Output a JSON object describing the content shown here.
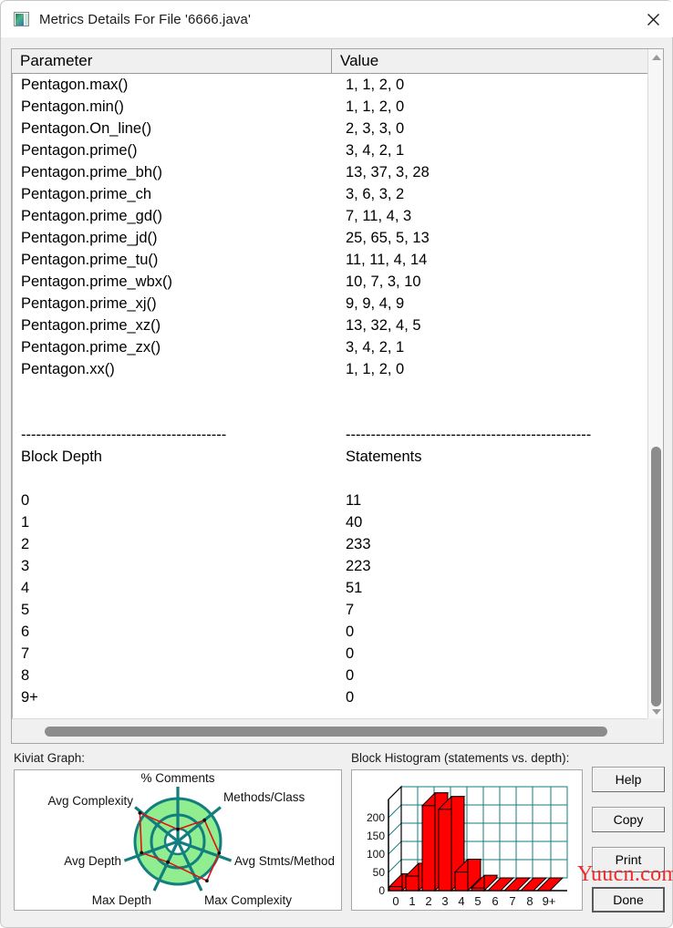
{
  "window": {
    "title": "Metrics Details For File '6666.java'",
    "icon": "app-window-icon",
    "close_label": "×"
  },
  "table": {
    "columns": [
      "Parameter",
      "Value"
    ],
    "rows": [
      {
        "parameter": "Pentagon.max()",
        "value": "1, 1, 2, 0"
      },
      {
        "parameter": "Pentagon.min()",
        "value": "1, 1, 2, 0"
      },
      {
        "parameter": "Pentagon.On_line()",
        "value": "2, 3, 3, 0"
      },
      {
        "parameter": "Pentagon.prime()",
        "value": "3, 4, 2, 1"
      },
      {
        "parameter": "Pentagon.prime_bh()",
        "value": "13, 37, 3, 28"
      },
      {
        "parameter": "Pentagon.prime_ch",
        "value": "3, 6, 3, 2"
      },
      {
        "parameter": "Pentagon.prime_gd()",
        "value": "7, 11, 4, 3"
      },
      {
        "parameter": "Pentagon.prime_jd()",
        "value": "25, 65, 5, 13"
      },
      {
        "parameter": "Pentagon.prime_tu()",
        "value": "11, 11, 4, 14"
      },
      {
        "parameter": "Pentagon.prime_wbx()",
        "value": "10, 7, 3, 10"
      },
      {
        "parameter": "Pentagon.prime_xj()",
        "value": "9, 9, 4, 9"
      },
      {
        "parameter": "Pentagon.prime_xz()",
        "value": "13, 32, 4, 5"
      },
      {
        "parameter": "Pentagon.prime_zx()",
        "value": "3, 4, 2, 1"
      },
      {
        "parameter": "Pentagon.xx()",
        "value": "1, 1, 2, 0"
      }
    ],
    "separator_left": "-----------------------------------------",
    "separator_right": "-------------------------------------------------",
    "section": {
      "headers": [
        "Block Depth",
        "Statements"
      ],
      "rows": [
        {
          "depth": "0",
          "statements": "11"
        },
        {
          "depth": "1",
          "statements": "40"
        },
        {
          "depth": "2",
          "statements": "233"
        },
        {
          "depth": "3",
          "statements": "223"
        },
        {
          "depth": "4",
          "statements": "51"
        },
        {
          "depth": "5",
          "statements": "7"
        },
        {
          "depth": "6",
          "statements": "0"
        },
        {
          "depth": "7",
          "statements": "0"
        },
        {
          "depth": "8",
          "statements": "0"
        },
        {
          "depth": "9+",
          "statements": "0"
        }
      ]
    }
  },
  "panels": {
    "kiviat_label": "Kiviat Graph:",
    "histogram_label": "Block Histogram (statements vs. depth):"
  },
  "kiviat": {
    "axes": [
      {
        "label": "% Comments",
        "value": 0.22
      },
      {
        "label": "Methods/Class",
        "value": 0.62
      },
      {
        "label": "Avg Stmts/Method",
        "value": 0.96
      },
      {
        "label": "Max Complexity",
        "value": 1.08
      },
      {
        "label": "Max Depth",
        "value": 0.42
      },
      {
        "label": "Avg Depth",
        "value": 0.78
      },
      {
        "label": "Avg Complexity",
        "value": 1.1
      }
    ],
    "band_color": "#90ee90",
    "axis_color": "#127e7e",
    "plot_color": "#e21111"
  },
  "chart_data": {
    "type": "bar",
    "title": "Block Histogram (statements vs. depth)",
    "xlabel": "depth",
    "ylabel": "statements",
    "categories": [
      "0",
      "1",
      "2",
      "3",
      "4",
      "5",
      "6",
      "7",
      "8",
      "9+"
    ],
    "values": [
      11,
      40,
      233,
      223,
      51,
      7,
      0,
      0,
      0,
      0
    ],
    "yticks": [
      0,
      50,
      100,
      150,
      200
    ],
    "ylim": [
      0,
      250
    ],
    "grid": true,
    "bar_color": "#ff0000",
    "grid_color": "#127e7e",
    "legend": "none",
    "style": "3d"
  },
  "buttons": [
    {
      "label": "Help",
      "focused": false
    },
    {
      "label": "Copy",
      "focused": false
    },
    {
      "label": "Print",
      "focused": false
    },
    {
      "label": "Done",
      "focused": true
    }
  ],
  "watermark": {
    "text": "Yuucn.com",
    "color": "#ef2a2a"
  }
}
